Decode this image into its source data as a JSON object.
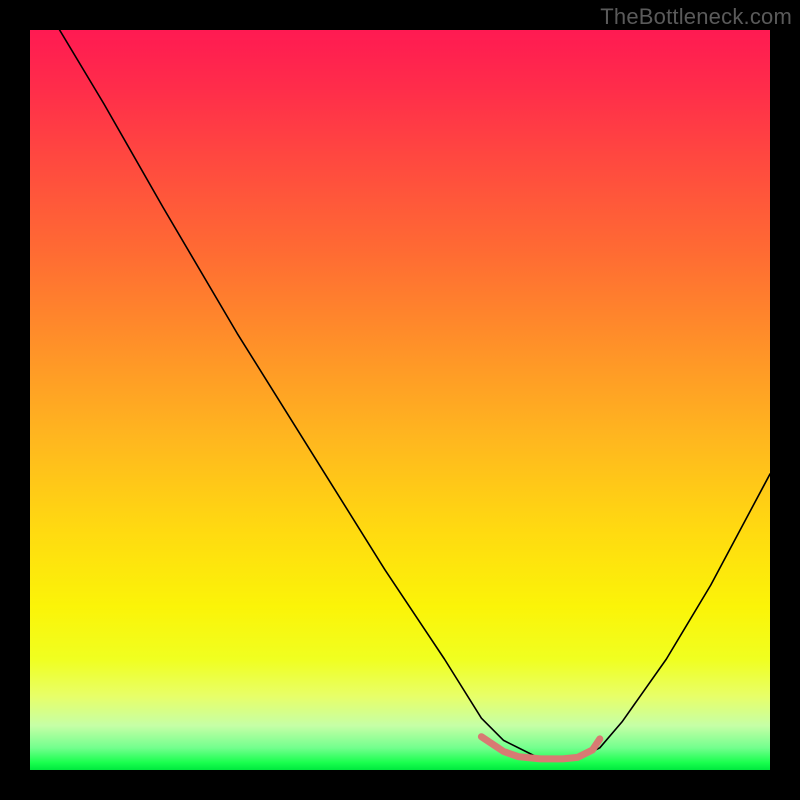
{
  "watermark": "TheBottleneck.com",
  "colors": {
    "background": "#000000",
    "gradient_top": "#ff1a52",
    "gradient_bottom": "#00e83e",
    "curve": "#000000",
    "bottom_accent": "#d87a73"
  },
  "chart_data": {
    "type": "line",
    "title": "",
    "xlabel": "",
    "ylabel": "",
    "xlim": [
      0,
      100
    ],
    "ylim": [
      0,
      100
    ],
    "notes": "Axes unlabeled in source image; values are relative percentages of plot area. y is visually inverted (0 at top, 100 at bottom).",
    "series": [
      {
        "name": "bottleneck-curve",
        "x": [
          4,
          10,
          18,
          28,
          38,
          48,
          56,
          61,
          64,
          69,
          74,
          77,
          80,
          86,
          92,
          100
        ],
        "y": [
          0,
          10,
          24,
          41,
          57,
          73,
          85,
          93,
          96,
          98.5,
          98.5,
          97,
          93.5,
          85,
          75,
          60
        ]
      },
      {
        "name": "bottom-accent",
        "x": [
          61,
          64,
          66,
          69,
          72,
          74,
          76,
          77
        ],
        "y": [
          95.5,
          97.5,
          98.2,
          98.5,
          98.5,
          98.3,
          97.3,
          95.8
        ]
      }
    ]
  }
}
